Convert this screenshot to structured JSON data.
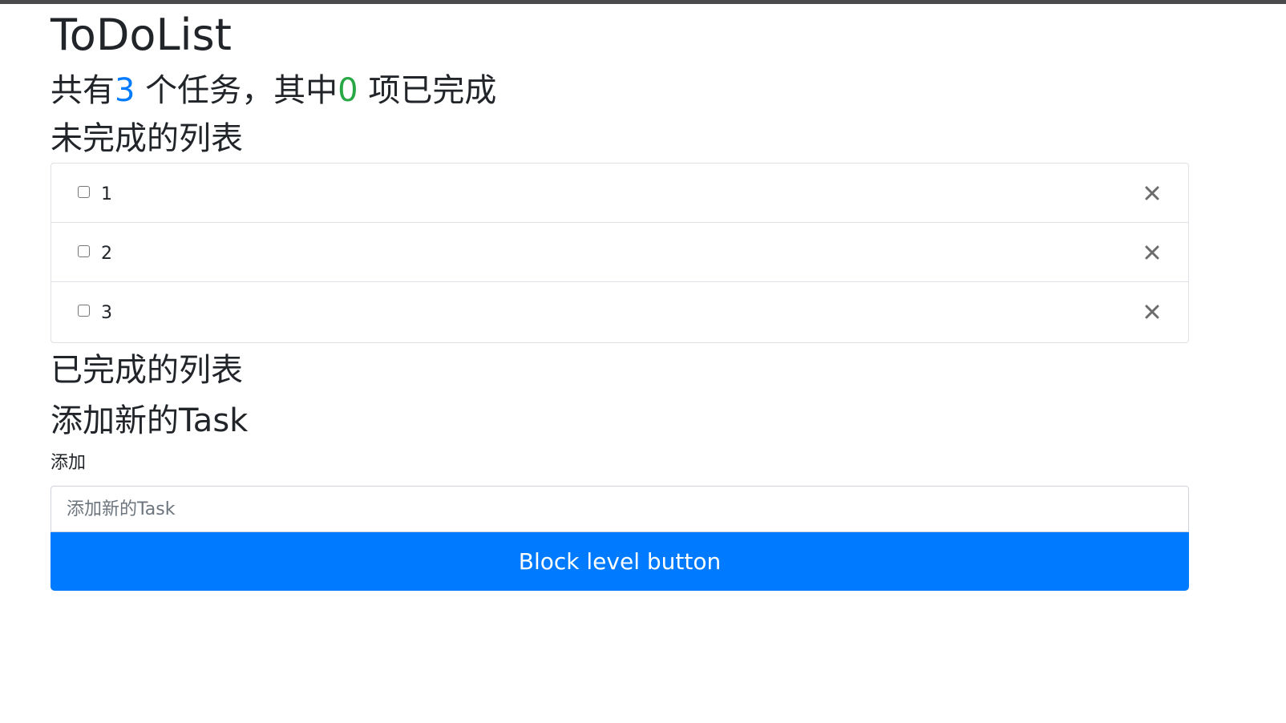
{
  "app": {
    "title": "ToDoList"
  },
  "summary": {
    "prefix": "共有",
    "total": "3",
    "middle": " 个任务，其中",
    "completed": "0",
    "suffix": " 项已完成",
    "colors": {
      "total": "#007bff",
      "completed": "#28a745"
    }
  },
  "incomplete": {
    "title": "未完成的列表",
    "tasks": [
      {
        "text": "1",
        "checked": false,
        "delete_icon": "close-icon"
      },
      {
        "text": "2",
        "checked": false,
        "delete_icon": "close-icon"
      },
      {
        "text": "3",
        "checked": false,
        "delete_icon": "close-icon"
      }
    ]
  },
  "completed_section": {
    "title": "已完成的列表"
  },
  "add_form": {
    "title": "添加新的Task",
    "label": "添加",
    "placeholder": "添加新的Task",
    "value": "",
    "button_label": "Block level button",
    "button_color": "#007bff"
  }
}
